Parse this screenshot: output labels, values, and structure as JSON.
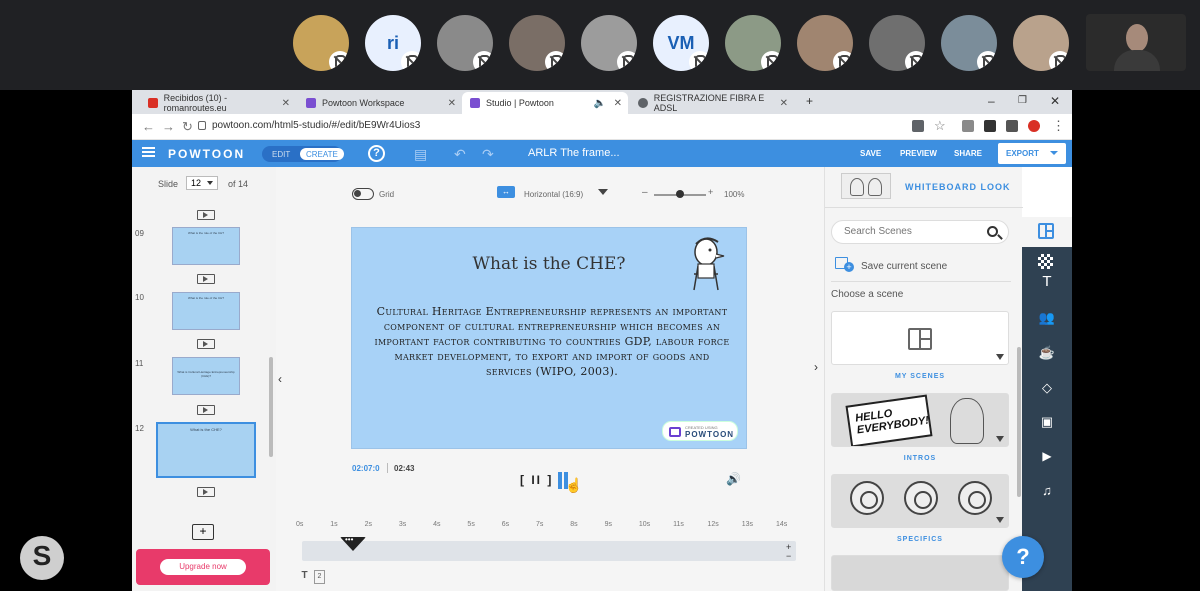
{
  "meeting": {
    "participants": [
      {
        "kind": "photo",
        "color": "#c8a35a"
      },
      {
        "kind": "initials",
        "initials": "ri"
      },
      {
        "kind": "photo",
        "color": "#8a8a8a"
      },
      {
        "kind": "photo",
        "color": "#7a6e66"
      },
      {
        "kind": "photo",
        "color": "#9c9c9c"
      },
      {
        "kind": "initials",
        "initials": "VM"
      },
      {
        "kind": "photo",
        "color": "#8c9a86"
      },
      {
        "kind": "photo",
        "color": "#a08570"
      },
      {
        "kind": "photo",
        "color": "#6f6f6f"
      },
      {
        "kind": "photo",
        "color": "#7b8d9a"
      },
      {
        "kind": "photo",
        "color": "#b9a28c"
      }
    ]
  },
  "browser": {
    "tabs": [
      {
        "label": "Recibidos (10) - romanroutes.eu",
        "favicon_color": "#d93025"
      },
      {
        "label": "Powtoon Workspace",
        "favicon_color": "#7a4fd1"
      },
      {
        "label": "Studio | Powtoon",
        "favicon_color": "#7a4fd1"
      },
      {
        "label": "REGISTRAZIONE FIBRA E ADSL",
        "favicon_color": "#5f6368"
      }
    ],
    "url": "powtoon.com/html5-studio/#/edit/bE9Wr4Uios3"
  },
  "toolbar": {
    "logo": "POWTOON",
    "edit_label": "EDIT",
    "create_label": "CREATE",
    "help_label": "?",
    "project_title": "ARLR The frame...",
    "save_label": "SAVE",
    "preview_label": "PREVIEW",
    "share_label": "SHARE",
    "export_label": "EXPORT",
    "accent": "#3d8fe0"
  },
  "slides": {
    "slide_label": "Slide",
    "current": "12",
    "of_label": "of 14",
    "items": [
      {
        "num": "09",
        "title": "What is the role of the CH?"
      },
      {
        "num": "10",
        "title": "What is the role of the CH?"
      },
      {
        "num": "11",
        "title": "What is Cultural Heritage Entrepreneurship (CHE)?"
      },
      {
        "num": "12",
        "title": "What is the CHE?"
      }
    ],
    "add_label": "+",
    "upgrade_label": "Upgrade now",
    "upgrade_color": "#e83a6a"
  },
  "canvas": {
    "grid_label": "Grid",
    "orientation": "Horizontal (16:9)",
    "zoom_minus": "–",
    "zoom_plus": "+",
    "zoom": "100%",
    "zoom_level": 0.5,
    "slide_title": "What is the CHE?",
    "slide_body": "Cultural Heritage Entrepreneurship represents an important component of cultural entrepreneurship which becomes an important factor contributing to countries GDP, labour force market development, to export and import of goods and services (WIPO, 2003).",
    "badge_small": "CREATED USING",
    "badge_big": "POWTOON",
    "slide_bg": "#a8d2f7"
  },
  "player": {
    "current_time": "02:07:0",
    "total_time": "02:43",
    "pause_label": "[ II ]",
    "ticks": [
      "0s",
      "1s",
      "2s",
      "3s",
      "4s",
      "5s",
      "6s",
      "7s",
      "8s",
      "9s",
      "10s",
      "11s",
      "12s",
      "13s",
      "14s"
    ],
    "plus": "+",
    "minus": "−",
    "track_text": "T",
    "track_num": "2"
  },
  "right_panel": {
    "look_label": "WHITEBOARD LOOK",
    "search_placeholder": "Search Scenes",
    "save_scene": "Save current scene",
    "choose_label": "Choose a scene",
    "categories": [
      {
        "label": "MY SCENES"
      },
      {
        "label": "INTROS",
        "bubble": "HELLO EVERYBODY!"
      },
      {
        "label": "SPECIFICS"
      }
    ],
    "help_fab": "?"
  },
  "rail": {
    "icons": [
      "layout-icon",
      "background-icon",
      "text-icon",
      "characters-icon",
      "props-icon",
      "shapes-icon",
      "images-icon",
      "video-icon",
      "music-icon"
    ]
  }
}
